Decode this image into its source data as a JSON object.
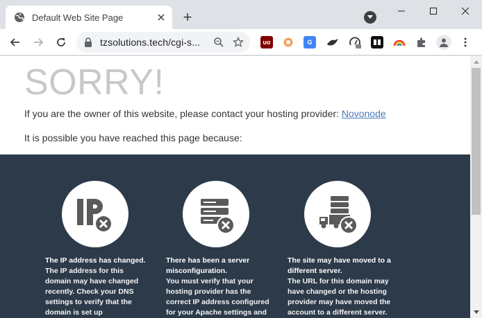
{
  "tab": {
    "title": "Default Web Site Page",
    "favicon": "globe-icon",
    "close": "close-icon"
  },
  "new_tab": "+",
  "window_controls": [
    "minimize-icon",
    "maximize-icon",
    "close-icon"
  ],
  "toolbar": {
    "url": "tzsolutions.tech/cgi-s...",
    "extensions": [
      "ublock-icon",
      "extension-orange-icon",
      "translate-icon",
      "extension-bird-icon",
      "speed-icon",
      "extension-dark-icon",
      "extension-rainbow-icon",
      "puzzle-icon",
      "profile-icon",
      "menu-icon"
    ]
  },
  "page": {
    "heading": "SORRY!",
    "owner_text": "If you are the owner of this website, please contact your hosting provider: ",
    "provider_link": "Novonode",
    "reason_intro": "It is possible you have reached this page because:",
    "reasons": [
      {
        "icon": "ip-error-icon",
        "title": "The IP address has changed.",
        "body": "The IP address for this domain may have changed recently. Check your DNS settings to verify that the domain is set up"
      },
      {
        "icon": "server-error-icon",
        "title": "There has been a server misconfiguration.",
        "body": "You must verify that your hosting provider has the correct IP address configured for your Apache settings and"
      },
      {
        "icon": "server-moved-icon",
        "title": "The site may have moved to a different server.",
        "body": "The URL for this domain may have changed or the hosting provider may have moved the account to a different server."
      }
    ]
  },
  "colors": {
    "dark_band": "#2c3a49",
    "heading": "#c8c8c8",
    "link": "#4a7ab5",
    "icon_fill": "#5a5a5a"
  }
}
